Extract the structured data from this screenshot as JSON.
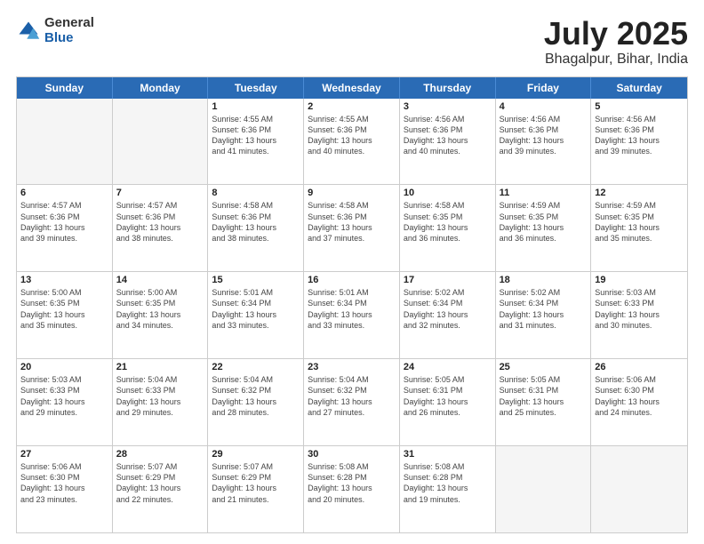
{
  "logo": {
    "general": "General",
    "blue": "Blue"
  },
  "title": "July 2025",
  "location": "Bhagalpur, Bihar, India",
  "days": [
    "Sunday",
    "Monday",
    "Tuesday",
    "Wednesday",
    "Thursday",
    "Friday",
    "Saturday"
  ],
  "rows": [
    [
      {
        "day": "",
        "lines": []
      },
      {
        "day": "",
        "lines": []
      },
      {
        "day": "1",
        "lines": [
          "Sunrise: 4:55 AM",
          "Sunset: 6:36 PM",
          "Daylight: 13 hours",
          "and 41 minutes."
        ]
      },
      {
        "day": "2",
        "lines": [
          "Sunrise: 4:55 AM",
          "Sunset: 6:36 PM",
          "Daylight: 13 hours",
          "and 40 minutes."
        ]
      },
      {
        "day": "3",
        "lines": [
          "Sunrise: 4:56 AM",
          "Sunset: 6:36 PM",
          "Daylight: 13 hours",
          "and 40 minutes."
        ]
      },
      {
        "day": "4",
        "lines": [
          "Sunrise: 4:56 AM",
          "Sunset: 6:36 PM",
          "Daylight: 13 hours",
          "and 39 minutes."
        ]
      },
      {
        "day": "5",
        "lines": [
          "Sunrise: 4:56 AM",
          "Sunset: 6:36 PM",
          "Daylight: 13 hours",
          "and 39 minutes."
        ]
      }
    ],
    [
      {
        "day": "6",
        "lines": [
          "Sunrise: 4:57 AM",
          "Sunset: 6:36 PM",
          "Daylight: 13 hours",
          "and 39 minutes."
        ]
      },
      {
        "day": "7",
        "lines": [
          "Sunrise: 4:57 AM",
          "Sunset: 6:36 PM",
          "Daylight: 13 hours",
          "and 38 minutes."
        ]
      },
      {
        "day": "8",
        "lines": [
          "Sunrise: 4:58 AM",
          "Sunset: 6:36 PM",
          "Daylight: 13 hours",
          "and 38 minutes."
        ]
      },
      {
        "day": "9",
        "lines": [
          "Sunrise: 4:58 AM",
          "Sunset: 6:36 PM",
          "Daylight: 13 hours",
          "and 37 minutes."
        ]
      },
      {
        "day": "10",
        "lines": [
          "Sunrise: 4:58 AM",
          "Sunset: 6:35 PM",
          "Daylight: 13 hours",
          "and 36 minutes."
        ]
      },
      {
        "day": "11",
        "lines": [
          "Sunrise: 4:59 AM",
          "Sunset: 6:35 PM",
          "Daylight: 13 hours",
          "and 36 minutes."
        ]
      },
      {
        "day": "12",
        "lines": [
          "Sunrise: 4:59 AM",
          "Sunset: 6:35 PM",
          "Daylight: 13 hours",
          "and 35 minutes."
        ]
      }
    ],
    [
      {
        "day": "13",
        "lines": [
          "Sunrise: 5:00 AM",
          "Sunset: 6:35 PM",
          "Daylight: 13 hours",
          "and 35 minutes."
        ]
      },
      {
        "day": "14",
        "lines": [
          "Sunrise: 5:00 AM",
          "Sunset: 6:35 PM",
          "Daylight: 13 hours",
          "and 34 minutes."
        ]
      },
      {
        "day": "15",
        "lines": [
          "Sunrise: 5:01 AM",
          "Sunset: 6:34 PM",
          "Daylight: 13 hours",
          "and 33 minutes."
        ]
      },
      {
        "day": "16",
        "lines": [
          "Sunrise: 5:01 AM",
          "Sunset: 6:34 PM",
          "Daylight: 13 hours",
          "and 33 minutes."
        ]
      },
      {
        "day": "17",
        "lines": [
          "Sunrise: 5:02 AM",
          "Sunset: 6:34 PM",
          "Daylight: 13 hours",
          "and 32 minutes."
        ]
      },
      {
        "day": "18",
        "lines": [
          "Sunrise: 5:02 AM",
          "Sunset: 6:34 PM",
          "Daylight: 13 hours",
          "and 31 minutes."
        ]
      },
      {
        "day": "19",
        "lines": [
          "Sunrise: 5:03 AM",
          "Sunset: 6:33 PM",
          "Daylight: 13 hours",
          "and 30 minutes."
        ]
      }
    ],
    [
      {
        "day": "20",
        "lines": [
          "Sunrise: 5:03 AM",
          "Sunset: 6:33 PM",
          "Daylight: 13 hours",
          "and 29 minutes."
        ]
      },
      {
        "day": "21",
        "lines": [
          "Sunrise: 5:04 AM",
          "Sunset: 6:33 PM",
          "Daylight: 13 hours",
          "and 29 minutes."
        ]
      },
      {
        "day": "22",
        "lines": [
          "Sunrise: 5:04 AM",
          "Sunset: 6:32 PM",
          "Daylight: 13 hours",
          "and 28 minutes."
        ]
      },
      {
        "day": "23",
        "lines": [
          "Sunrise: 5:04 AM",
          "Sunset: 6:32 PM",
          "Daylight: 13 hours",
          "and 27 minutes."
        ]
      },
      {
        "day": "24",
        "lines": [
          "Sunrise: 5:05 AM",
          "Sunset: 6:31 PM",
          "Daylight: 13 hours",
          "and 26 minutes."
        ]
      },
      {
        "day": "25",
        "lines": [
          "Sunrise: 5:05 AM",
          "Sunset: 6:31 PM",
          "Daylight: 13 hours",
          "and 25 minutes."
        ]
      },
      {
        "day": "26",
        "lines": [
          "Sunrise: 5:06 AM",
          "Sunset: 6:30 PM",
          "Daylight: 13 hours",
          "and 24 minutes."
        ]
      }
    ],
    [
      {
        "day": "27",
        "lines": [
          "Sunrise: 5:06 AM",
          "Sunset: 6:30 PM",
          "Daylight: 13 hours",
          "and 23 minutes."
        ]
      },
      {
        "day": "28",
        "lines": [
          "Sunrise: 5:07 AM",
          "Sunset: 6:29 PM",
          "Daylight: 13 hours",
          "and 22 minutes."
        ]
      },
      {
        "day": "29",
        "lines": [
          "Sunrise: 5:07 AM",
          "Sunset: 6:29 PM",
          "Daylight: 13 hours",
          "and 21 minutes."
        ]
      },
      {
        "day": "30",
        "lines": [
          "Sunrise: 5:08 AM",
          "Sunset: 6:28 PM",
          "Daylight: 13 hours",
          "and 20 minutes."
        ]
      },
      {
        "day": "31",
        "lines": [
          "Sunrise: 5:08 AM",
          "Sunset: 6:28 PM",
          "Daylight: 13 hours",
          "and 19 minutes."
        ]
      },
      {
        "day": "",
        "lines": []
      },
      {
        "day": "",
        "lines": []
      }
    ]
  ]
}
